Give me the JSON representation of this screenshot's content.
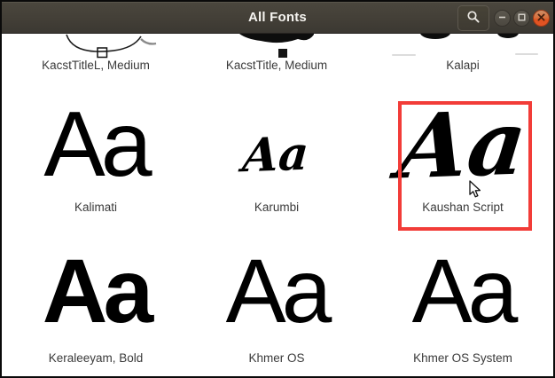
{
  "window": {
    "title": "All Fonts"
  },
  "titlebar": {
    "search_button": {
      "icon": "magnifier"
    },
    "window_controls": [
      "minimize",
      "maximize",
      "close"
    ]
  },
  "fonts": {
    "row1": [
      {
        "name": "KacstTitleL, Medium"
      },
      {
        "name": "KacstTitle, Medium"
      },
      {
        "name": "Kalapi"
      }
    ],
    "row2": [
      {
        "name": "Kalimati",
        "preview": "Aa"
      },
      {
        "name": "Karumbi",
        "preview": "Aa"
      },
      {
        "name": "Kaushan Script",
        "preview": "Aa",
        "selected": true
      }
    ],
    "row3": [
      {
        "name": "Keraleeyam, Bold",
        "preview": "Aa"
      },
      {
        "name": "Khmer OS",
        "preview": "Aa"
      },
      {
        "name": "Khmer OS System",
        "preview": "Aa"
      }
    ]
  },
  "colors": {
    "titlebar_bg": "#433f37",
    "titlebar_text": "#f6f4f0",
    "close_button": "#e25426",
    "selection_border": "#f23c38",
    "label_text": "#3a3a3a",
    "content_bg": "#ffffff"
  }
}
